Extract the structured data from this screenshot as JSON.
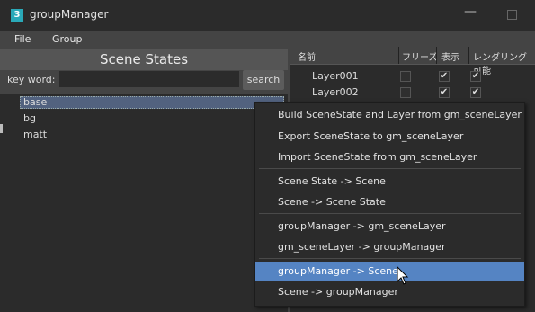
{
  "window": {
    "title": "groupManager",
    "app_icon_glyph": "3"
  },
  "menu": [
    "File",
    "Group"
  ],
  "left": {
    "title": "Scene States",
    "keyword_label": "key word:",
    "keyword_value": "",
    "search_label": "search",
    "states": [
      "base",
      "bg",
      "matt"
    ],
    "selected_state": "base"
  },
  "right": {
    "headers": [
      "名前",
      "フリーズ",
      "表示",
      "レンダリング可能"
    ],
    "layers": [
      {
        "name": "Layer001",
        "freeze": false,
        "visible": true,
        "renderable": true
      },
      {
        "name": "Layer002",
        "freeze": false,
        "visible": true,
        "renderable": true
      }
    ],
    "check_glyph": "✔"
  },
  "context_menu": {
    "groups": [
      [
        "Build SceneState and Layer from gm_sceneLayer",
        "Export SceneState to gm_sceneLayer",
        "Import SceneState from gm_sceneLayer"
      ],
      [
        "Scene State -> Scene",
        "Scene -> Scene State"
      ],
      [
        "groupManager -> gm_sceneLayer",
        "gm_sceneLayer -> groupManager"
      ],
      [
        "groupManager -> Scene",
        "Scene -> groupManager"
      ]
    ],
    "highlighted": "groupManager -> Scene"
  },
  "colors": {
    "highlight": "#5584c3",
    "selection": "#52627f",
    "icon": "#2aa9b8"
  }
}
